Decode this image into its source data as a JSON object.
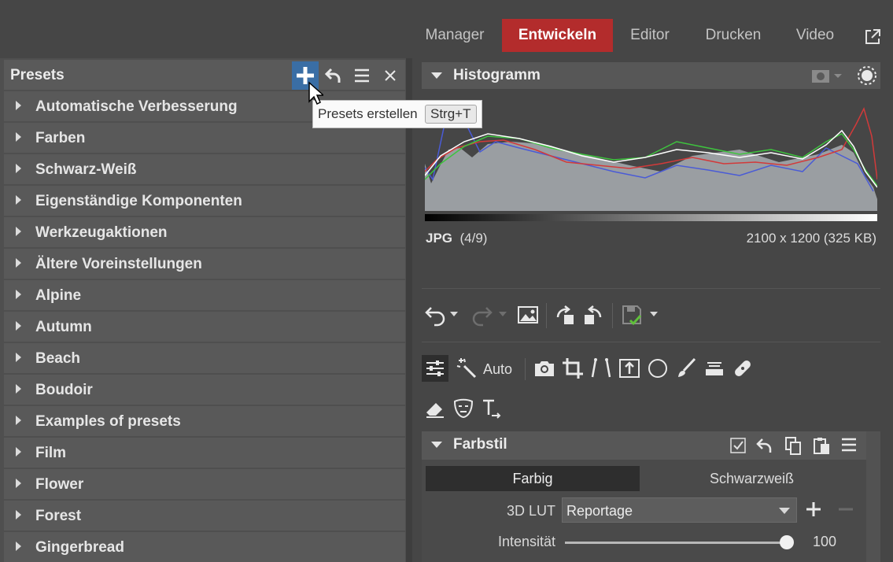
{
  "nav": {
    "tabs": [
      {
        "label": "Manager"
      },
      {
        "label": "Entwickeln"
      },
      {
        "label": "Editor"
      },
      {
        "label": "Drucken"
      },
      {
        "label": "Video"
      }
    ],
    "active_tab": "Entwickeln"
  },
  "presets": {
    "title": "Presets",
    "items": [
      {
        "label": "Automatische Verbesserung"
      },
      {
        "label": "Farben"
      },
      {
        "label": "Schwarz-Weiß"
      },
      {
        "label": "Eigenständige Komponenten"
      },
      {
        "label": "Werkzeugaktionen"
      },
      {
        "label": "Ältere Voreinstellungen"
      },
      {
        "label": "Alpine"
      },
      {
        "label": "Autumn"
      },
      {
        "label": "Beach"
      },
      {
        "label": "Boudoir"
      },
      {
        "label": "Examples of presets"
      },
      {
        "label": "Film"
      },
      {
        "label": "Flower"
      },
      {
        "label": "Forest"
      },
      {
        "label": "Gingerbread"
      }
    ]
  },
  "tooltip": {
    "text": "Presets erstellen",
    "shortcut": "Strg+T"
  },
  "histogram": {
    "title": "Histogramm",
    "file_format": "JPG",
    "file_index": "(4/9)",
    "dimensions": "2100 x 1200 (325 KB)"
  },
  "tools": {
    "auto_label": "Auto",
    "icons": [
      "sliders-icon",
      "magic-wand-icon",
      "camera-icon",
      "crop-icon",
      "perspective-icon",
      "tilt-shift-icon",
      "radial-filter-icon",
      "brush-icon",
      "gradient-icon",
      "healing-icon",
      "eraser-icon",
      "mask-icon",
      "text-icon"
    ]
  },
  "farbstil": {
    "title": "Farbstil",
    "modes": [
      "Farbig",
      "Schwarzweiß"
    ],
    "selected_mode": "Farbig",
    "lut_label": "3D LUT",
    "lut_value": "Reportage",
    "intensity_label": "Intensität",
    "intensity_value": "100"
  },
  "colors": {
    "accent_active_tab": "#b32c2c",
    "add_button_bg": "#3a6ea5"
  }
}
